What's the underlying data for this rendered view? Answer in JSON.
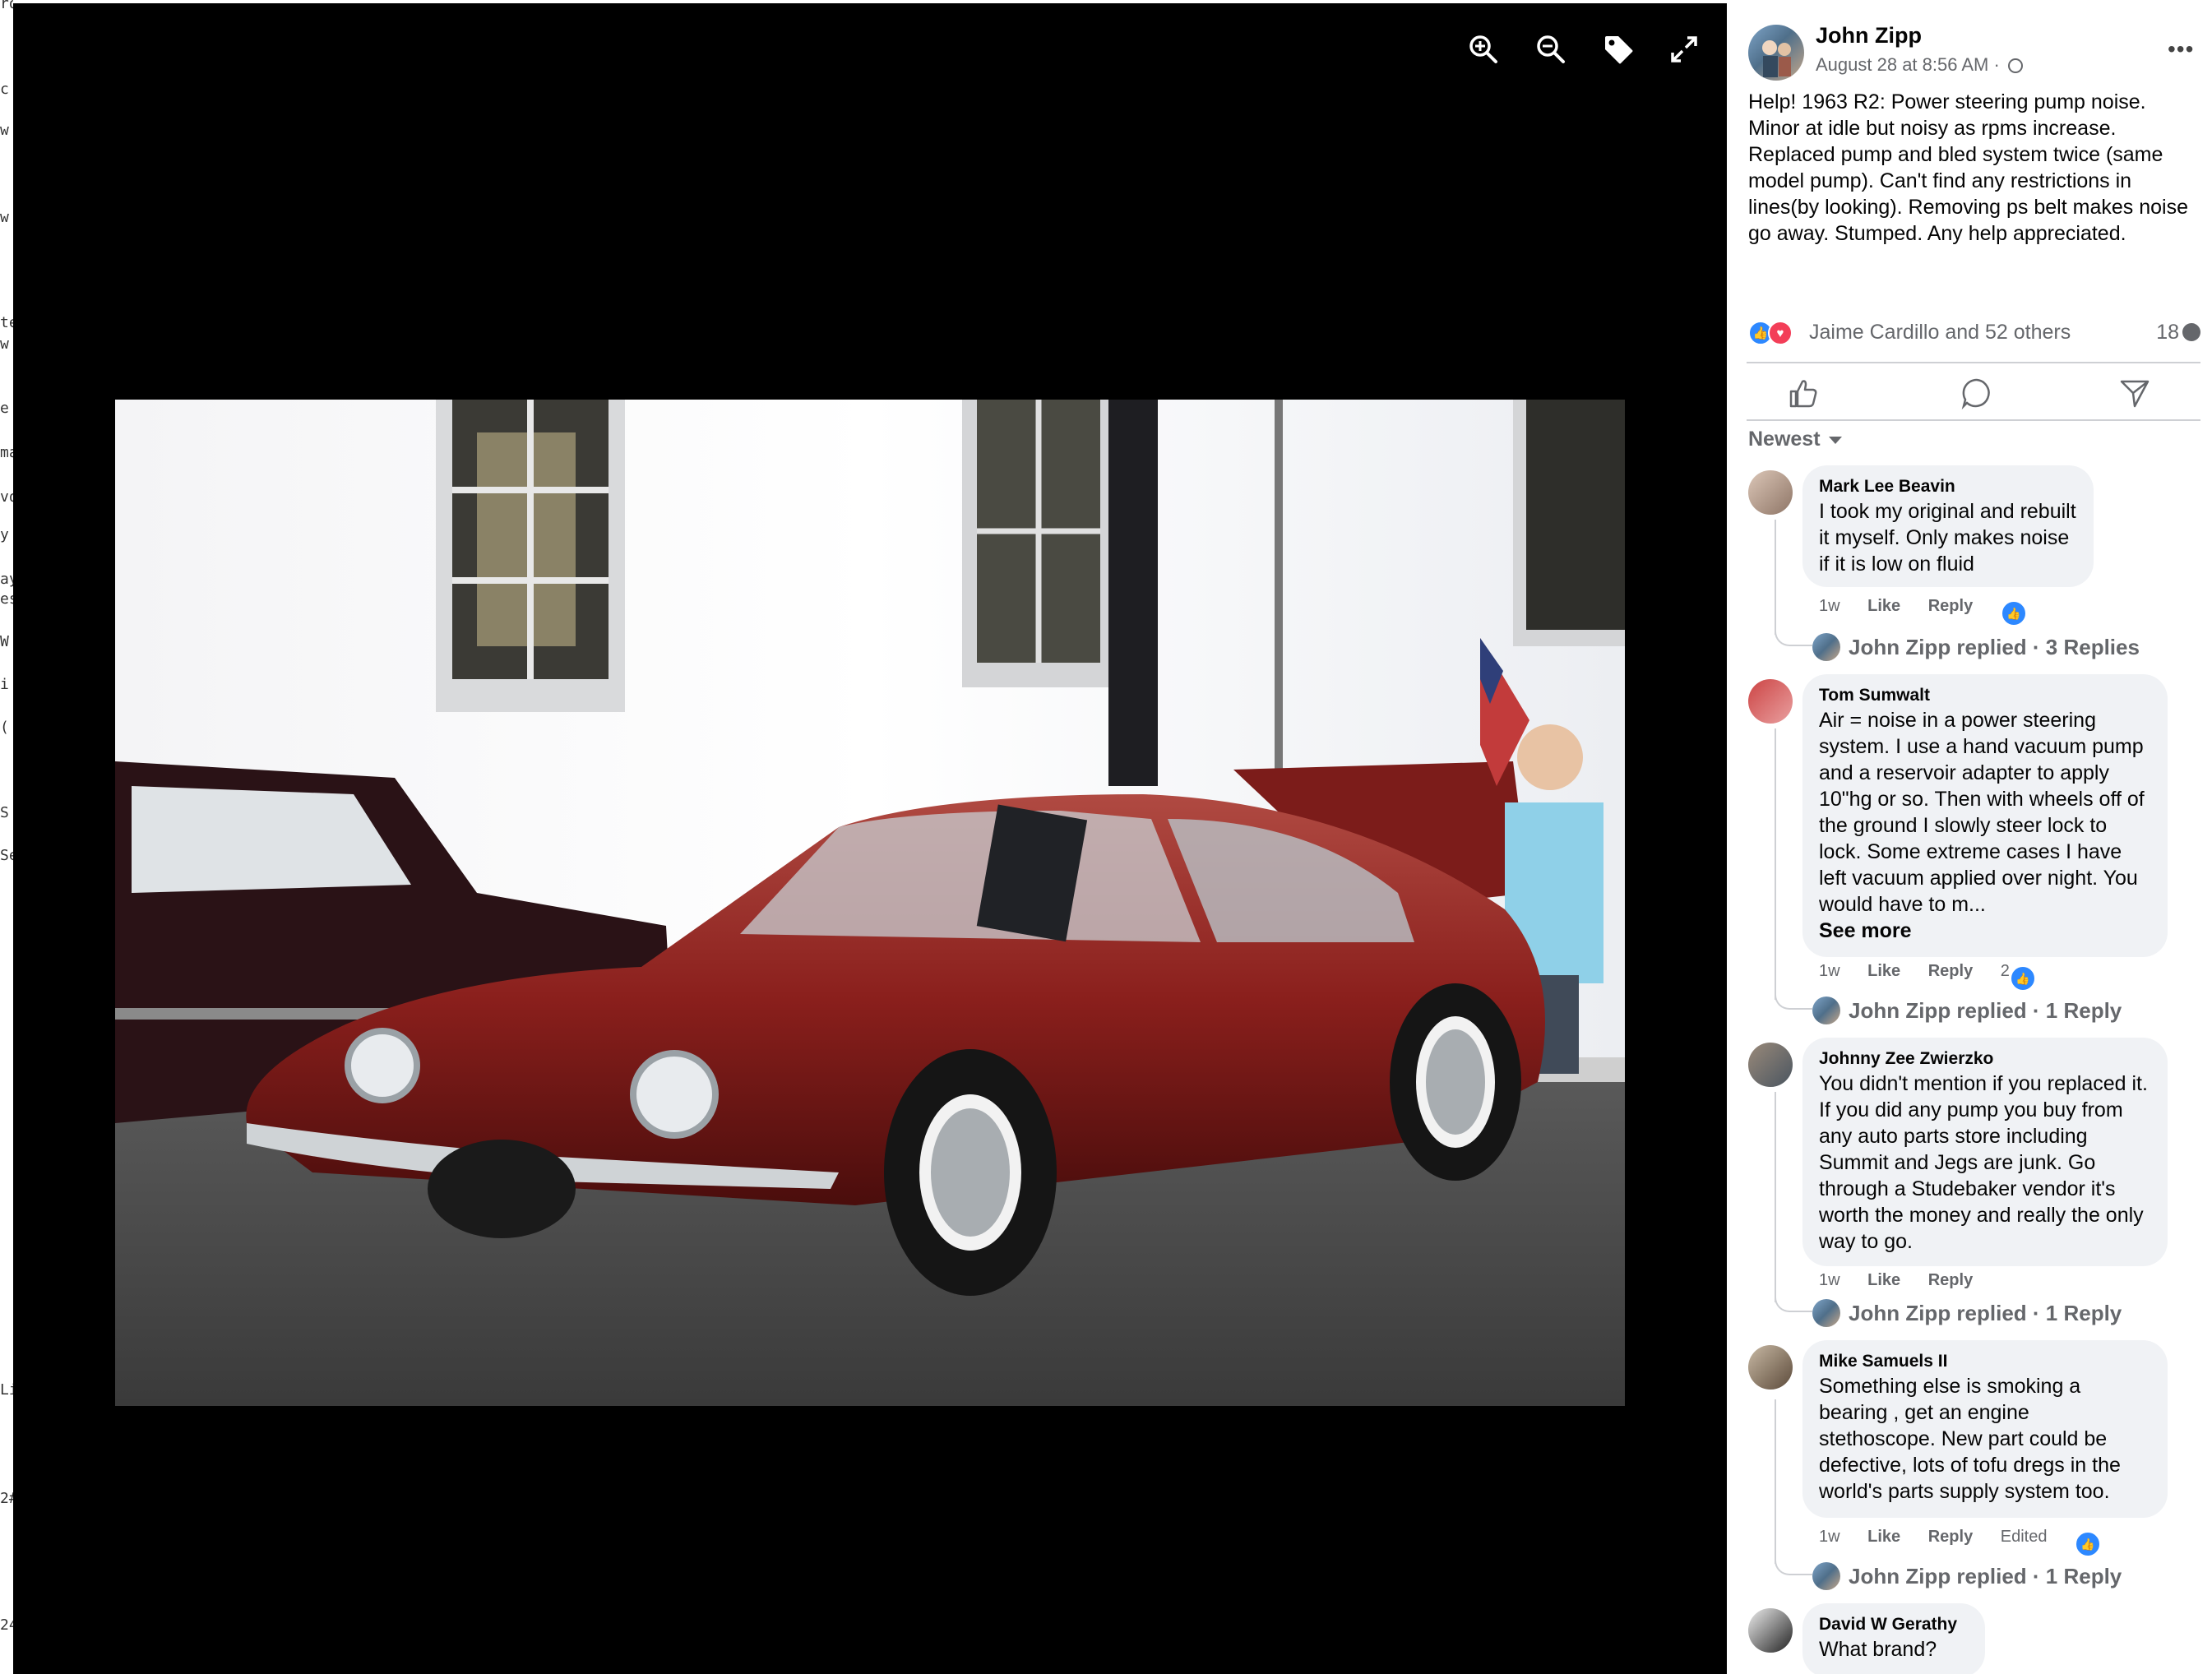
{
  "edge_strip": [
    "ro",
    "c",
    "w",
    "w",
    "te",
    "w",
    "e",
    "ma",
    "vo",
    "y",
    "ay",
    "es",
    "W",
    "i",
    "(",
    "S",
    "Se",
    "Li",
    "2#",
    "24"
  ],
  "viewer": {
    "tools": [
      "zoom-in-icon",
      "zoom-out-icon",
      "tag-icon",
      "fullscreen-icon"
    ]
  },
  "post": {
    "author": "John Zipp",
    "time": "August 28 at 8:56 AM · ",
    "more": "•••",
    "text": "Help! 1963 R2: Power steering pump noise. Minor at idle but noisy as rpms increase. Replaced pump and bled system twice (same model pump). Can't find any restrictions in lines(by looking). Removing ps belt makes noise go away. Stumped. Any help appreciated.",
    "reactors": "Jaime Cardillo and 52 others",
    "comment_count": "18",
    "sort": "Newest"
  },
  "comments": [
    {
      "name": "Mark Lee Beavin",
      "text": "I took my original and rebuilt it myself. Only makes noise if it is low on fluid",
      "time": "1w",
      "like": "Like",
      "reply": "Reply",
      "reactions": "",
      "replies": "John Zipp replied · 3 Replies"
    },
    {
      "name": "Tom Sumwalt",
      "text": "Air = noise in a power steering system. I use a hand vacuum pump and a reservoir adapter to apply 10\"hg or so. Then with wheels off of the ground I slowly steer lock to lock. Some extreme cases I have left vacuum applied over night. You would have to m...",
      "see_more": "See more",
      "time": "1w",
      "like": "Like",
      "reply": "Reply",
      "reactions": "2",
      "replies": "John Zipp replied · 1 Reply"
    },
    {
      "name": "Johnny Zee Zwierzko",
      "text": "You didn't mention if you replaced it. If you did any pump you buy from any auto parts store including Summit and Jegs are junk. Go through a Studebaker vendor it's worth the money and really the only way to go.",
      "time": "1w",
      "like": "Like",
      "reply": "Reply",
      "replies": "John Zipp replied · 1 Reply"
    },
    {
      "name": "Mike Samuels II",
      "text": "Something else is smoking a bearing , get an engine stethoscope. New part could be defective, lots of tofu dregs in the world's parts supply system too.",
      "time": "1w",
      "like": "Like",
      "reply": "Reply",
      "edited": "Edited",
      "replies": "John Zipp replied · 1 Reply"
    },
    {
      "name": "David W Gerathy",
      "text": "What brand?"
    }
  ],
  "colors": {
    "accent": "#2d88ff",
    "love": "#f33e58",
    "muted": "#65676b",
    "bubble": "#f0f2f5"
  }
}
